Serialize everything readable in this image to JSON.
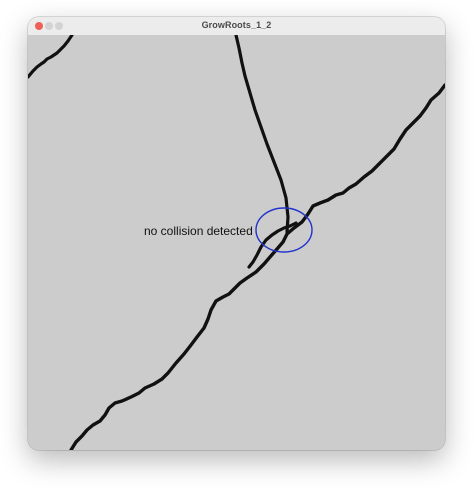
{
  "window": {
    "title": "GrowRoots_1_2",
    "controls": [
      "close",
      "minimize",
      "zoom"
    ]
  },
  "canvas": {
    "background": "#cccccc",
    "root_color": "#111111",
    "circle_color": "#2233cc",
    "status_text": "no collision detected"
  }
}
